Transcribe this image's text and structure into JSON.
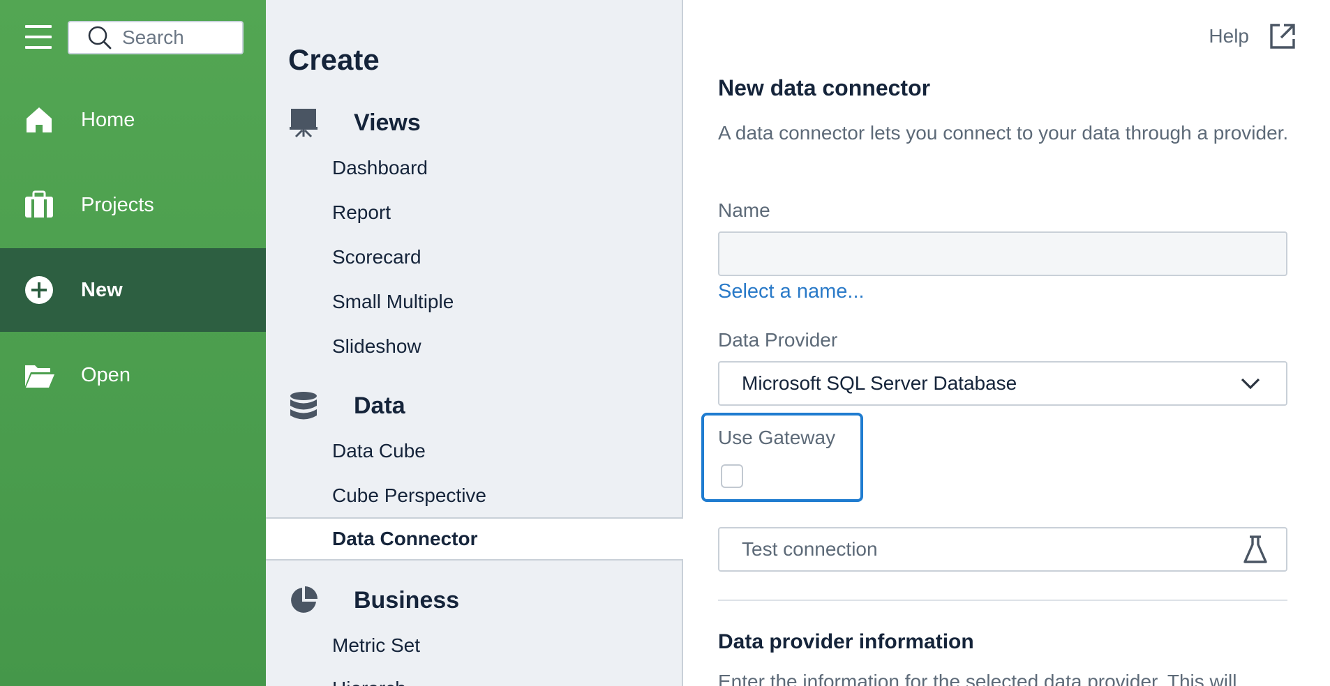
{
  "nav": {
    "search_placeholder": "Search",
    "items": [
      {
        "label": "Home",
        "icon": "home-icon"
      },
      {
        "label": "Projects",
        "icon": "briefcase-icon"
      },
      {
        "label": "New",
        "icon": "plus-circle-icon",
        "active": true
      },
      {
        "label": "Open",
        "icon": "folder-open-icon"
      }
    ]
  },
  "create": {
    "title": "Create",
    "sections": [
      {
        "title": "Views",
        "icon": "presentation-board-icon",
        "items": [
          "Dashboard",
          "Report",
          "Scorecard",
          "Small Multiple",
          "Slideshow"
        ]
      },
      {
        "title": "Data",
        "icon": "database-icon",
        "items": [
          "Data Cube",
          "Cube Perspective",
          "Data Connector"
        ]
      },
      {
        "title": "Business",
        "icon": "pie-chart-icon",
        "items": [
          "Metric Set",
          "Hierarch"
        ]
      }
    ],
    "selected_item": "Data Connector"
  },
  "form": {
    "help_label": "Help",
    "title": "New data connector",
    "description": "A data connector lets you connect to your data through a provider.",
    "name_label": "Name",
    "name_value": "",
    "name_hint": "Select a name...",
    "provider_label": "Data Provider",
    "provider_value": "Microsoft SQL Server Database",
    "gateway_label": "Use Gateway",
    "gateway_checked": false,
    "test_label": "Test connection",
    "info_title": "Data provider information",
    "info_desc": "Enter the information for the selected data provider. This will"
  },
  "colors": {
    "nav_green": "#4e9f50",
    "nav_active": "#2d5f41",
    "link_blue": "#2a7ac8",
    "focus_blue": "#1f7cd0"
  }
}
